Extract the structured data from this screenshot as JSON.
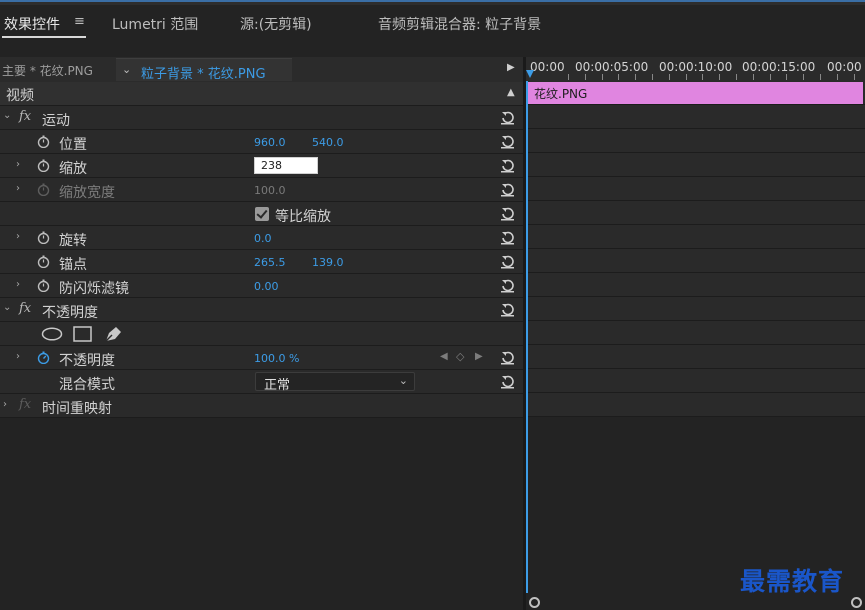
{
  "tabs": [
    {
      "label": "效果控件"
    },
    {
      "label": "Lumetri 范围"
    },
    {
      "label": "源:(无剪辑)"
    },
    {
      "label": "音频剪辑混合器: 粒子背景"
    }
  ],
  "tab_menu_icon": "≡",
  "clip_bar": {
    "master": "主要 * 花纹.PNG",
    "sequence_clip": "粒子背景 * 花纹.PNG"
  },
  "video_section": {
    "label": "视频"
  },
  "effects": {
    "motion": {
      "label": "运动",
      "position": {
        "label": "位置",
        "x": "960.0",
        "y": "540.0"
      },
      "scale": {
        "label": "缩放",
        "value": "238"
      },
      "scale_width": {
        "label": "缩放宽度",
        "value": "100.0"
      },
      "uniform_scale": {
        "label": "等比缩放",
        "checked": true
      },
      "rotation": {
        "label": "旋转",
        "value": "0.0"
      },
      "anchor": {
        "label": "锚点",
        "x": "265.5",
        "y": "139.0"
      },
      "anti_flicker": {
        "label": "防闪烁滤镜",
        "value": "0.00"
      }
    },
    "opacity": {
      "label": "不透明度",
      "mask_tools": [
        "ellipse-mask-icon",
        "rectangle-mask-icon",
        "pen-mask-icon"
      ],
      "opacity": {
        "label": "不透明度",
        "value": "100.0 %"
      },
      "blend_mode": {
        "label": "混合模式",
        "value": "正常"
      }
    },
    "time_remap": {
      "label": "时间重映射"
    }
  },
  "timeline": {
    "timecodes": [
      "00:00",
      "00:00:05:00",
      "00:00:10:00",
      "00:00:15:00",
      "00:00"
    ],
    "clip_label": "花纹.PNG",
    "clip_color": "#e085e0",
    "playhead_color": "#3c9ce6"
  },
  "watermark": "最需教育",
  "colors": {
    "value_blue": "#3c9ce6",
    "panel_bg": "#232323"
  }
}
